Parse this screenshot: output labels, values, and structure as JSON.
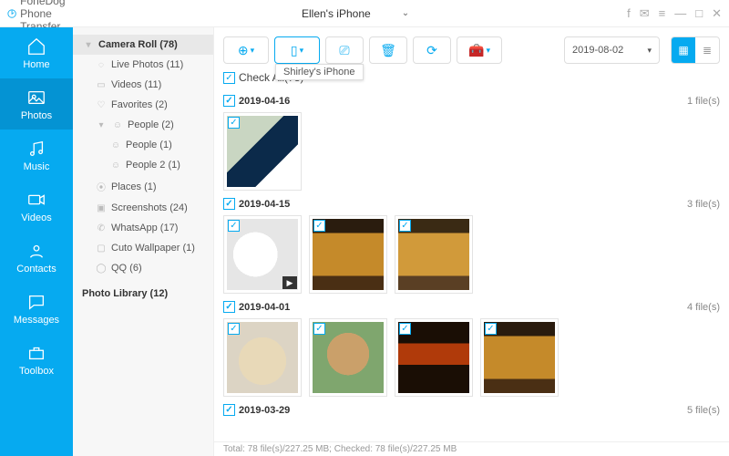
{
  "app": {
    "name": "FoneDog Phone Transfer"
  },
  "device": {
    "icon": "apple",
    "name": "Ellen's iPhone"
  },
  "nav": [
    {
      "label": "Home"
    },
    {
      "label": "Photos"
    },
    {
      "label": "Music"
    },
    {
      "label": "Videos"
    },
    {
      "label": "Contacts"
    },
    {
      "label": "Messages"
    },
    {
      "label": "Toolbox"
    }
  ],
  "sidebar": {
    "section": "Camera Roll (78)",
    "items": [
      {
        "label": "Live Photos (11)"
      },
      {
        "label": "Videos (11)"
      },
      {
        "label": "Favorites (2)"
      },
      {
        "label": "People (2)",
        "expandable": true
      },
      {
        "label": "People (1)",
        "child": true
      },
      {
        "label": "People 2 (1)",
        "child": true
      },
      {
        "label": "Places (1)"
      },
      {
        "label": "Screenshots (24)"
      },
      {
        "label": "WhatsApp (17)"
      },
      {
        "label": "Cuto Wallpaper (1)"
      },
      {
        "label": "QQ (6)"
      }
    ],
    "library": "Photo Library (12)"
  },
  "toolbar": {
    "tooltip": "Shirley's iPhone",
    "date": "2019-08-02"
  },
  "checkall": "Check All(78)",
  "groups": [
    {
      "date": "2019-04-16",
      "count": "1 file(s)"
    },
    {
      "date": "2019-04-15",
      "count": "3 file(s)"
    },
    {
      "date": "2019-04-01",
      "count": "4 file(s)"
    },
    {
      "date": "2019-03-29",
      "count": "5 file(s)"
    }
  ],
  "status": "Total: 78 file(s)/227.25 MB; Checked: 78 file(s)/227.25 MB"
}
